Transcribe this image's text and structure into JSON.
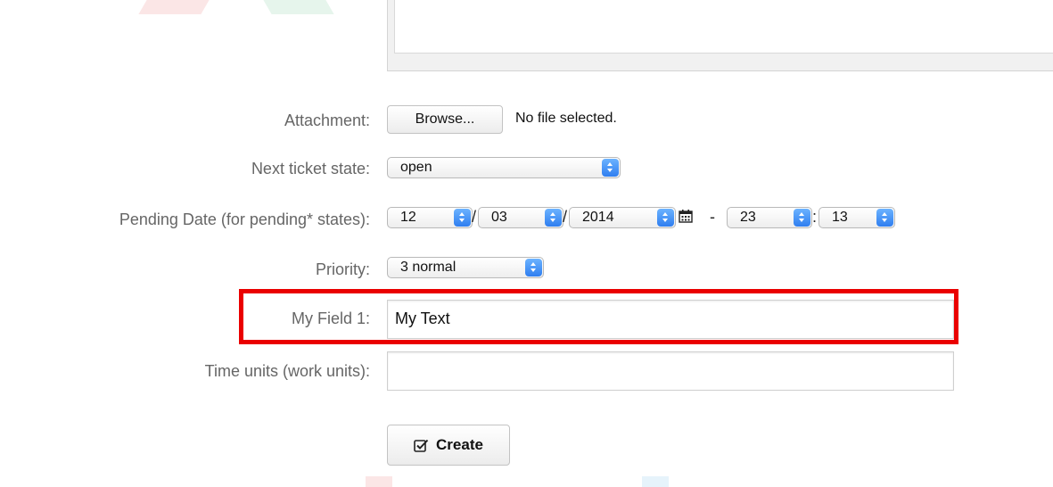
{
  "form": {
    "attachment": {
      "label": "Attachment:",
      "browse_label": "Browse...",
      "file_status": "No file selected."
    },
    "next_state": {
      "label": "Next ticket state:",
      "value": "open"
    },
    "pending_date": {
      "label": "Pending Date (for pending* states):",
      "day": "12",
      "month": "03",
      "year": "2014",
      "hour": "23",
      "minute": "13",
      "date_sep": "/",
      "time_dash": "-",
      "time_sep": ":"
    },
    "priority": {
      "label": "Priority:",
      "value": "3 normal"
    },
    "my_field_1": {
      "label": "My Field 1:",
      "value": "My Text"
    },
    "time_units": {
      "label": "Time units (work units):",
      "value": ""
    },
    "create_label": "Create"
  },
  "colors": {
    "highlight": "#ea0000",
    "select_arrow": "#2f7ef0"
  },
  "icons": [
    "calendar-icon",
    "checkbox-icon",
    "select-arrow-icon"
  ]
}
